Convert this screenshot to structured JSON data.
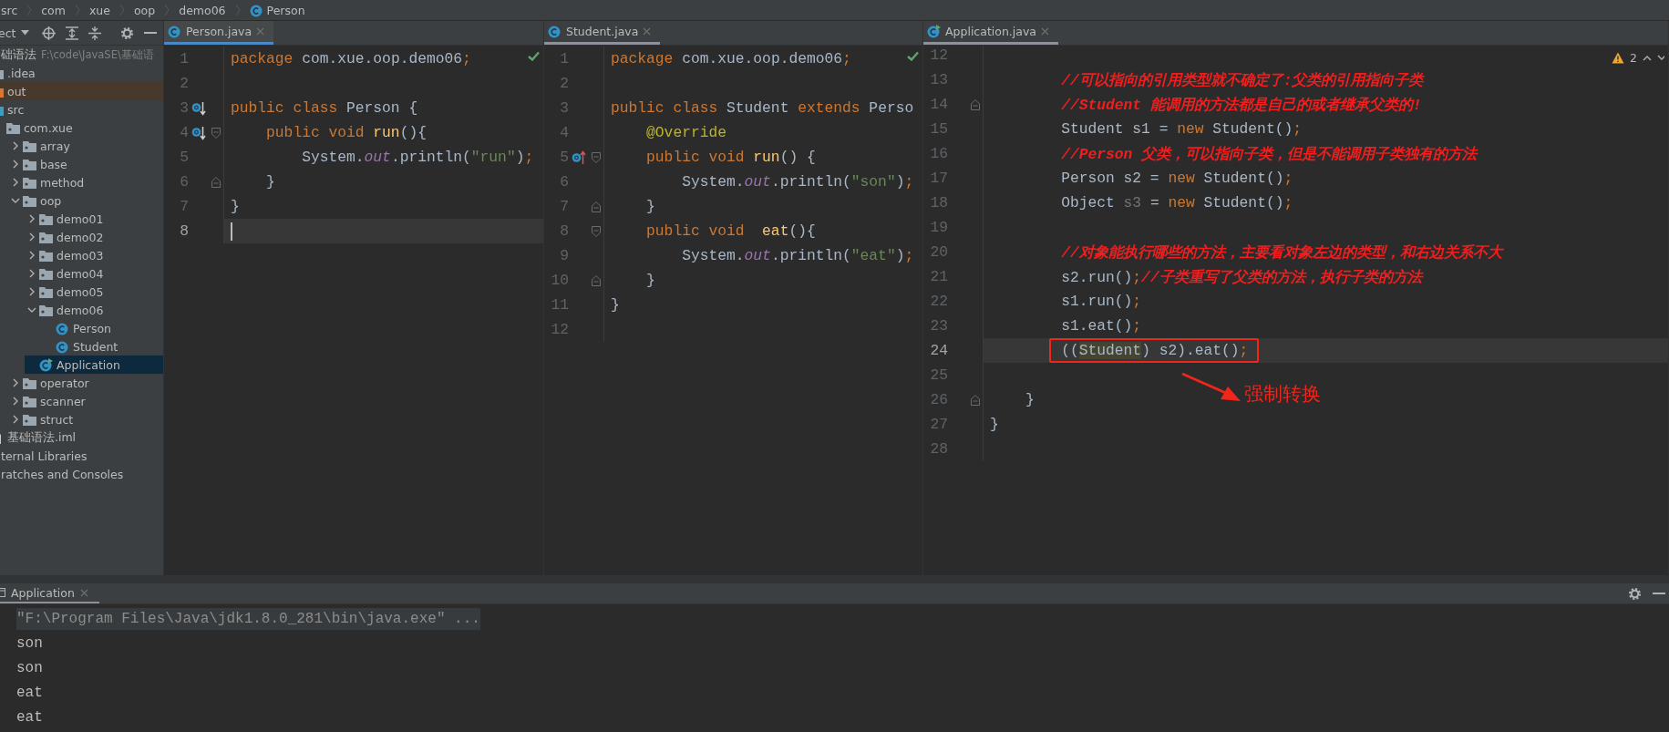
{
  "breadcrumbs": [
    {
      "label": "src"
    },
    {
      "label": "com"
    },
    {
      "label": "xue"
    },
    {
      "label": "oop"
    },
    {
      "label": "demo06"
    },
    {
      "label": "Person",
      "kind": "class"
    }
  ],
  "project_panel": {
    "view_label": "ect",
    "tree": [
      {
        "label": "础语法",
        "detail": "F:\\code\\JavaSE\\基础语",
        "selected": false,
        "children": [
          {
            "label": ".idea",
            "kind": "folder",
            "selected": false
          },
          {
            "label": "out",
            "kind": "excluded-folder",
            "selected": false
          },
          {
            "label": "src",
            "kind": "source-folder",
            "selected": false,
            "children": [
              {
                "label": "com.xue",
                "kind": "package",
                "selected": false,
                "children": [
                  {
                    "label": "array",
                    "kind": "package",
                    "expanded": false,
                    "selected": false
                  },
                  {
                    "label": "base",
                    "kind": "package",
                    "expanded": false,
                    "selected": false
                  },
                  {
                    "label": "method",
                    "kind": "package",
                    "expanded": false,
                    "selected": false
                  },
                  {
                    "label": "oop",
                    "kind": "package",
                    "expanded": true,
                    "selected": false,
                    "children": [
                      {
                        "label": "demo01",
                        "kind": "package",
                        "expanded": false,
                        "selected": false
                      },
                      {
                        "label": "demo02",
                        "kind": "package",
                        "expanded": false,
                        "selected": false
                      },
                      {
                        "label": "demo03",
                        "kind": "package",
                        "expanded": false,
                        "selected": false
                      },
                      {
                        "label": "demo04",
                        "kind": "package",
                        "expanded": false,
                        "selected": false
                      },
                      {
                        "label": "demo05",
                        "kind": "package",
                        "expanded": false,
                        "selected": false
                      },
                      {
                        "label": "demo06",
                        "kind": "package",
                        "expanded": true,
                        "selected": false,
                        "children": [
                          {
                            "label": "Person",
                            "kind": "class",
                            "selected": false
                          },
                          {
                            "label": "Student",
                            "kind": "class",
                            "selected": false
                          }
                        ]
                      },
                      {
                        "label": "Application",
                        "kind": "runnable-class",
                        "selected": true
                      }
                    ]
                  },
                  {
                    "label": "operator",
                    "kind": "package",
                    "expanded": false,
                    "selected": false
                  },
                  {
                    "label": "scanner",
                    "kind": "package",
                    "expanded": false,
                    "selected": false
                  },
                  {
                    "label": "struct",
                    "kind": "package",
                    "expanded": false,
                    "selected": false
                  }
                ]
              }
            ]
          },
          {
            "label": "基础语法.iml",
            "kind": "module-file",
            "selected": false
          }
        ]
      },
      {
        "label": "ternal Libraries",
        "selected": false
      },
      {
        "label": "ratches and Consoles",
        "selected": false
      }
    ]
  },
  "editors": [
    {
      "tab": {
        "label": "Person.java",
        "kind": "class",
        "selected": true
      },
      "inspection": {
        "kind": "ok"
      },
      "lines": [
        {
          "number": "1",
          "current": false,
          "tokens": [
            {
              "text": "package",
              "kind": "kw"
            },
            {
              "text": " com.xue.oop.demo06",
              "kind": "plain"
            },
            {
              "text": ";",
              "kind": "kw"
            }
          ]
        },
        {
          "number": "2",
          "current": false
        },
        {
          "number": "3",
          "current": false,
          "gutter": {
            "kind": "overridden"
          },
          "tokens": [
            {
              "text": "public class",
              "kind": "kw"
            },
            {
              "text": " Person {",
              "kind": "plain"
            }
          ]
        },
        {
          "number": "4",
          "current": false,
          "gutter": {
            "kind": "overridden"
          },
          "fold": {
            "kind": "start"
          },
          "tokens": [
            {
              "text": "    public void",
              "kind": "kw"
            },
            {
              "text": " run",
              "kind": "decl"
            },
            {
              "text": "(){",
              "kind": "plain"
            }
          ]
        },
        {
          "number": "5",
          "current": false,
          "tokens": [
            {
              "text": "        System.",
              "kind": "plain"
            },
            {
              "text": "out",
              "kind": "field"
            },
            {
              "text": ".println(",
              "kind": "plain"
            },
            {
              "text": "\"run\"",
              "kind": "str"
            },
            {
              "text": ")",
              "kind": "plain"
            },
            {
              "text": ";",
              "kind": "kw"
            }
          ]
        },
        {
          "number": "6",
          "current": false,
          "fold": {
            "kind": "end"
          },
          "tokens": [
            {
              "text": "    }",
              "kind": "plain"
            }
          ]
        },
        {
          "number": "7",
          "current": false,
          "tokens": [
            {
              "text": "}",
              "kind": "plain"
            }
          ]
        },
        {
          "number": "8",
          "current": true
        }
      ]
    },
    {
      "tab": {
        "label": "Student.java",
        "kind": "class",
        "selected": false
      },
      "inspection": {
        "kind": "ok"
      },
      "lines": [
        {
          "number": "1",
          "current": false,
          "tokens": [
            {
              "text": "package",
              "kind": "kw"
            },
            {
              "text": " com.xue.oop.demo06",
              "kind": "plain"
            },
            {
              "text": ";",
              "kind": "kw"
            }
          ]
        },
        {
          "number": "2",
          "current": false
        },
        {
          "number": "3",
          "current": false,
          "tokens": [
            {
              "text": "public class",
              "kind": "kw"
            },
            {
              "text": " Student ",
              "kind": "plain"
            },
            {
              "text": "extends",
              "kind": "kw"
            },
            {
              "text": " Perso",
              "kind": "plain"
            }
          ]
        },
        {
          "number": "4",
          "current": false,
          "tokens": [
            {
              "text": "    @Override",
              "kind": "ann"
            }
          ]
        },
        {
          "number": "5",
          "current": false,
          "gutter": {
            "kind": "overrides"
          },
          "fold": {
            "kind": "start"
          },
          "tokens": [
            {
              "text": "    public void",
              "kind": "kw"
            },
            {
              "text": " run",
              "kind": "decl"
            },
            {
              "text": "() {",
              "kind": "plain"
            }
          ]
        },
        {
          "number": "6",
          "current": false,
          "tokens": [
            {
              "text": "        System.",
              "kind": "plain"
            },
            {
              "text": "out",
              "kind": "field"
            },
            {
              "text": ".println(",
              "kind": "plain"
            },
            {
              "text": "\"son\"",
              "kind": "str"
            },
            {
              "text": ")",
              "kind": "plain"
            },
            {
              "text": ";",
              "kind": "kw"
            }
          ]
        },
        {
          "number": "7",
          "current": false,
          "fold": {
            "kind": "end"
          },
          "tokens": [
            {
              "text": "    }",
              "kind": "plain"
            }
          ]
        },
        {
          "number": "8",
          "current": false,
          "fold": {
            "kind": "start"
          },
          "tokens": [
            {
              "text": "    public void",
              "kind": "kw"
            },
            {
              "text": "  eat",
              "kind": "decl"
            },
            {
              "text": "(){",
              "kind": "plain"
            }
          ]
        },
        {
          "number": "9",
          "current": false,
          "tokens": [
            {
              "text": "        System.",
              "kind": "plain"
            },
            {
              "text": "out",
              "kind": "field"
            },
            {
              "text": ".println(",
              "kind": "plain"
            },
            {
              "text": "\"eat\"",
              "kind": "str"
            },
            {
              "text": ")",
              "kind": "plain"
            },
            {
              "text": ";",
              "kind": "kw"
            }
          ]
        },
        {
          "number": "10",
          "current": false,
          "fold": {
            "kind": "end"
          },
          "tokens": [
            {
              "text": "    }",
              "kind": "plain"
            }
          ]
        },
        {
          "number": "11",
          "current": false,
          "tokens": [
            {
              "text": "}",
              "kind": "plain"
            }
          ]
        },
        {
          "number": "12",
          "current": false
        }
      ]
    },
    {
      "tab": {
        "label": "Application.java",
        "kind": "runnable-class",
        "selected": false
      },
      "inspection": {
        "kind": "warnings",
        "count": "2"
      },
      "callout": {
        "label": "强制转换"
      },
      "lines": [
        {
          "number": "12",
          "current": false
        },
        {
          "number": "13",
          "current": false,
          "tokens": [
            {
              "text": "        //可以指向的引用类型就不确定了:父类的引用指向子类",
              "kind": "comment"
            }
          ]
        },
        {
          "number": "14",
          "current": false,
          "fold": {
            "kind": "end"
          },
          "tokens": [
            {
              "text": "        //Student 能调用的方法都是自己的或者继承父类的!",
              "kind": "comment"
            }
          ]
        },
        {
          "number": "15",
          "current": false,
          "tokens": [
            {
              "text": "        Student s1 = ",
              "kind": "plain"
            },
            {
              "text": "new",
              "kind": "kw"
            },
            {
              "text": " Student()",
              "kind": "plain"
            },
            {
              "text": ";",
              "kind": "kw"
            }
          ]
        },
        {
          "number": "16",
          "current": false,
          "tokens": [
            {
              "text": "        //Person 父类，可以指向子类，但是不能调用子类独有的方法",
              "kind": "comment"
            }
          ]
        },
        {
          "number": "17",
          "current": false,
          "tokens": [
            {
              "text": "        Person s2 = ",
              "kind": "plain"
            },
            {
              "text": "new",
              "kind": "kw"
            },
            {
              "text": " Student()",
              "kind": "plain"
            },
            {
              "text": ";",
              "kind": "kw"
            }
          ]
        },
        {
          "number": "18",
          "current": false,
          "tokens": [
            {
              "text": "        Object ",
              "kind": "plain"
            },
            {
              "text": "s3",
              "kind": "unused"
            },
            {
              "text": " = ",
              "kind": "plain"
            },
            {
              "text": "new",
              "kind": "kw"
            },
            {
              "text": " Student()",
              "kind": "plain"
            },
            {
              "text": ";",
              "kind": "kw"
            }
          ]
        },
        {
          "number": "19",
          "current": false
        },
        {
          "number": "20",
          "current": false,
          "tokens": [
            {
              "text": "        //对象能执行哪些的方法，主要看对象左边的类型，和右边关系不大",
              "kind": "comment"
            }
          ]
        },
        {
          "number": "21",
          "current": false,
          "tokens": [
            {
              "text": "        s2.run()",
              "kind": "plain"
            },
            {
              "text": ";",
              "kind": "kw"
            },
            {
              "text": "//子类重写了父类的方法，执行子类的方法",
              "kind": "comment"
            }
          ]
        },
        {
          "number": "22",
          "current": false,
          "tokens": [
            {
              "text": "        s1.run()",
              "kind": "plain"
            },
            {
              "text": ";",
              "kind": "kw"
            }
          ]
        },
        {
          "number": "23",
          "current": false,
          "tokens": [
            {
              "text": "        s1.eat()",
              "kind": "plain"
            },
            {
              "text": ";",
              "kind": "kw"
            }
          ]
        },
        {
          "number": "24",
          "current": true,
          "boxed": true,
          "tokens": [
            {
              "text": "        ((",
              "kind": "plain"
            },
            {
              "text": "Student",
              "kind": "cast"
            },
            {
              "text": ") s2).eat()",
              "kind": "plain"
            },
            {
              "text": ";",
              "kind": "kw"
            }
          ]
        },
        {
          "number": "25",
          "current": false
        },
        {
          "number": "26",
          "current": false,
          "fold": {
            "kind": "end"
          },
          "tokens": [
            {
              "text": "    }",
              "kind": "plain"
            }
          ]
        },
        {
          "number": "27",
          "current": false,
          "tokens": [
            {
              "text": "}",
              "kind": "plain"
            }
          ]
        },
        {
          "number": "28",
          "current": false
        }
      ]
    }
  ],
  "run_panel": {
    "tab": {
      "label": "Application",
      "selected": true
    },
    "console": [
      {
        "text": "\"F:\\Program Files\\Java\\jdk1.8.0_281\\bin\\java.exe\" ...",
        "kind": "command"
      },
      {
        "text": "son",
        "kind": "output"
      },
      {
        "text": "son",
        "kind": "output"
      },
      {
        "text": "eat",
        "kind": "output"
      },
      {
        "text": "eat",
        "kind": "output"
      }
    ]
  }
}
